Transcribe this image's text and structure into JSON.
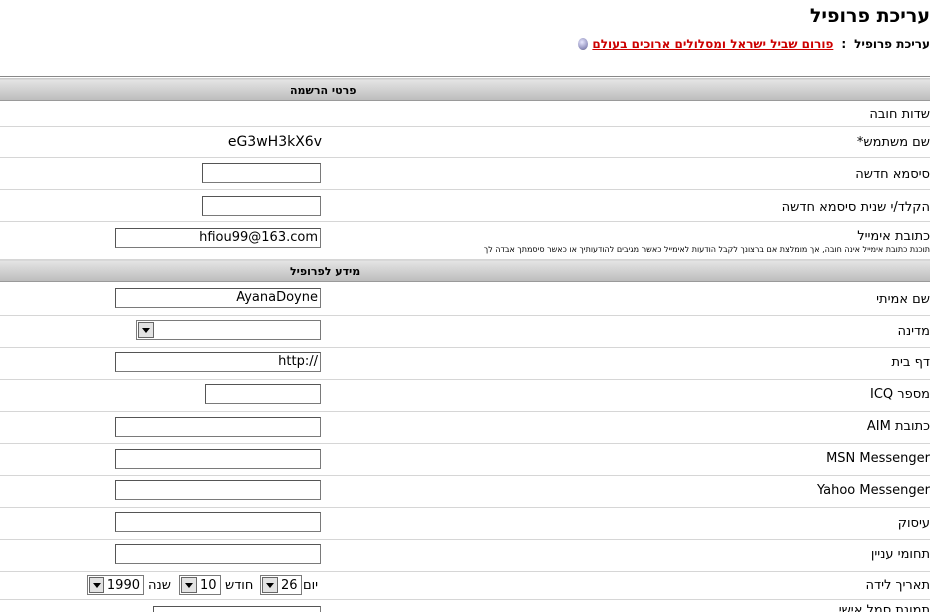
{
  "page": {
    "title": "עריכת פרופיל",
    "breadcrumb": {
      "forum_link": "פורום שביל ישראל ומסלולים ארוכים בעולם",
      "separator": ":",
      "current": "עריכת פרופיל"
    }
  },
  "registration": {
    "header": "פרטי הרשמה",
    "required_fields": "שדות חובה",
    "username_label": "שם משתמש*",
    "username_value": "eG3wH3kX6v",
    "new_password_label": "סיסמא חדשה",
    "confirm_password_label": "הקלד/י שנית סיסמא חדשה",
    "email_label": "כתובת אימייל",
    "email_value": "hfiou99@163.com",
    "email_hint": "תוכנת כתובת אימייל אינה חובה, אך מומלצת אם ברצונך לקבל הודעות לאימייל כאשר מגיבים להודעותיך או כאשר סיסמתך אבדה לך"
  },
  "profile": {
    "header": "מידע לפרופיל",
    "realname_label": "שם אמיתי",
    "realname_value": "AyanaDoyne",
    "country_label": "מדינה",
    "country_value": "",
    "homepage_label": "דף בית",
    "homepage_value": "http://",
    "icq_label": "מספר ICQ",
    "aim_label": "כתובת AIM",
    "msn_label": "MSN Messenger",
    "yahoo_label": "Yahoo Messenger",
    "occupation_label": "עיסוק",
    "interests_label": "תחומי עניין",
    "birthday_label": "תאריך לידה",
    "day_label": "יום",
    "day_value": "26",
    "month_label": "חודש",
    "month_value": "10",
    "year_label": "שנה",
    "year_value": "1990",
    "next_label": "תמונת סמל אישי"
  }
}
